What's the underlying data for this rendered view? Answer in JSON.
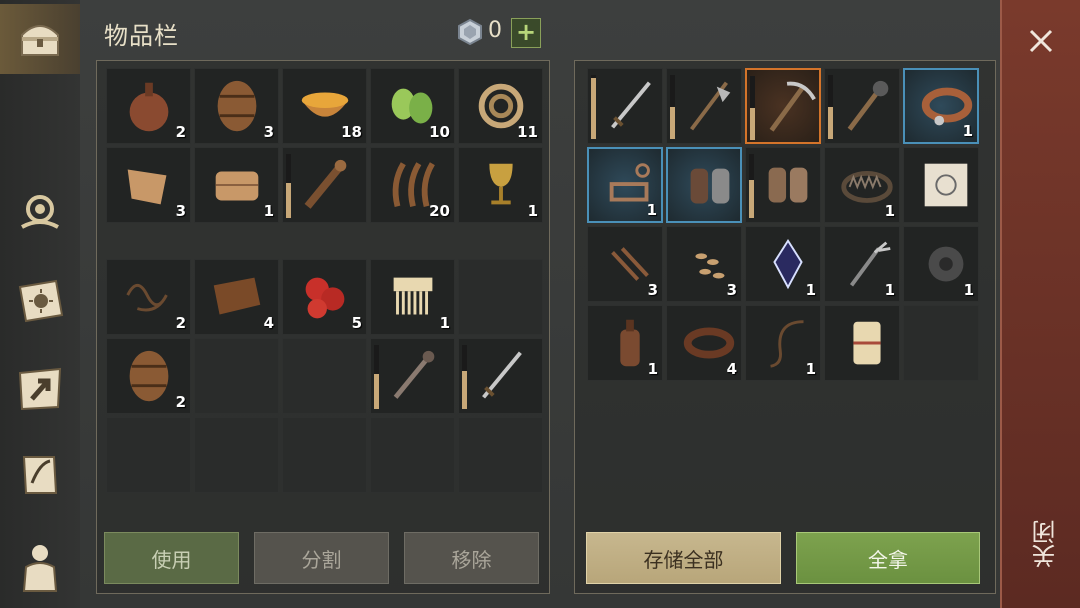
{
  "header": {
    "title": "物品栏",
    "coin_count": "0",
    "add_symbol": "+"
  },
  "inventory": {
    "slots_top": [
      {
        "icon": "flask-icon",
        "qty": "2"
      },
      {
        "icon": "barrel-icon",
        "qty": "3"
      },
      {
        "icon": "soup-bowl-icon",
        "qty": "18"
      },
      {
        "icon": "cucumber-slices-icon",
        "qty": "10"
      },
      {
        "icon": "rope-coil-icon",
        "qty": "11"
      },
      {
        "icon": "cloth-scraps-icon",
        "qty": "3"
      },
      {
        "icon": "folded-cloth-icon",
        "qty": "1"
      },
      {
        "icon": "spiked-club-icon",
        "qty": "",
        "durability": 0.55
      },
      {
        "icon": "dried-leaves-icon",
        "qty": "20"
      },
      {
        "icon": "goblet-icon",
        "qty": "1"
      }
    ],
    "slots_bottom": [
      {
        "icon": "string-icon",
        "qty": "2"
      },
      {
        "icon": "leather-roll-icon",
        "qty": "4"
      },
      {
        "icon": "berries-icon",
        "qty": "5"
      },
      {
        "icon": "comb-icon",
        "qty": "1"
      },
      {
        "icon": "",
        "qty": ""
      },
      {
        "icon": "barrel-icon",
        "qty": "2"
      },
      {
        "icon": "",
        "qty": ""
      },
      {
        "icon": "",
        "qty": ""
      },
      {
        "icon": "mace-icon",
        "qty": "",
        "durability": 0.55
      },
      {
        "icon": "sword-icon",
        "qty": "",
        "durability": 0.6
      },
      {
        "icon": "",
        "qty": ""
      },
      {
        "icon": "",
        "qty": ""
      },
      {
        "icon": "",
        "qty": ""
      },
      {
        "icon": "",
        "qty": ""
      },
      {
        "icon": "",
        "qty": ""
      }
    ],
    "buttons": {
      "use": "使用",
      "split": "分割",
      "remove": "移除"
    }
  },
  "storage": {
    "slots": [
      {
        "icon": "sword-icon",
        "qty": "",
        "durability": 0.95,
        "frame": ""
      },
      {
        "icon": "halberd-icon",
        "qty": "",
        "durability": 0.5,
        "frame": ""
      },
      {
        "icon": "pickaxe-icon",
        "qty": "",
        "durability": 0.5,
        "frame": "orange"
      },
      {
        "icon": "morning-star-icon",
        "qty": "",
        "durability": 0.5,
        "frame": ""
      },
      {
        "icon": "collar-icon",
        "qty": "1",
        "frame": "blue"
      },
      {
        "icon": "wind-key-icon",
        "qty": "1",
        "frame": "blue"
      },
      {
        "icon": "gauntlets-icon",
        "qty": "",
        "frame": "blue"
      },
      {
        "icon": "mail-gloves-icon",
        "qty": "",
        "durability": 0.6,
        "frame": ""
      },
      {
        "icon": "bear-trap-icon",
        "qty": "1",
        "frame": ""
      },
      {
        "icon": "map-scroll-icon",
        "qty": "",
        "frame": ""
      },
      {
        "icon": "nails-icon",
        "qty": "3",
        "frame": ""
      },
      {
        "icon": "seeds-icon",
        "qty": "3",
        "frame": ""
      },
      {
        "icon": "crystal-icon",
        "qty": "1",
        "frame": ""
      },
      {
        "icon": "fork-blade-icon",
        "qty": "1",
        "frame": ""
      },
      {
        "icon": "gear-icon",
        "qty": "1",
        "frame": ""
      },
      {
        "icon": "bottle-icon",
        "qty": "1",
        "frame": ""
      },
      {
        "icon": "leather-strap-icon",
        "qty": "4",
        "frame": ""
      },
      {
        "icon": "whip-icon",
        "qty": "1",
        "frame": ""
      },
      {
        "icon": "scroll-bundle-icon",
        "qty": "",
        "frame": ""
      },
      {
        "icon": "",
        "qty": "",
        "frame": ""
      }
    ],
    "buttons": {
      "store_all": "存储全部",
      "take_all": "全拿"
    }
  },
  "close": {
    "label": "关闭"
  },
  "sidebar": {
    "items": [
      {
        "icon": "chest-icon"
      },
      {
        "icon": "crafting-icon"
      },
      {
        "icon": "sun-book-icon"
      },
      {
        "icon": "map-arrow-icon"
      },
      {
        "icon": "quest-scroll-icon"
      },
      {
        "icon": "character-icon"
      }
    ]
  },
  "colors": {
    "accent": "#6b9140",
    "rare": "#4a90b8",
    "epic": "#d4742a",
    "close": "#7a3a2c"
  }
}
